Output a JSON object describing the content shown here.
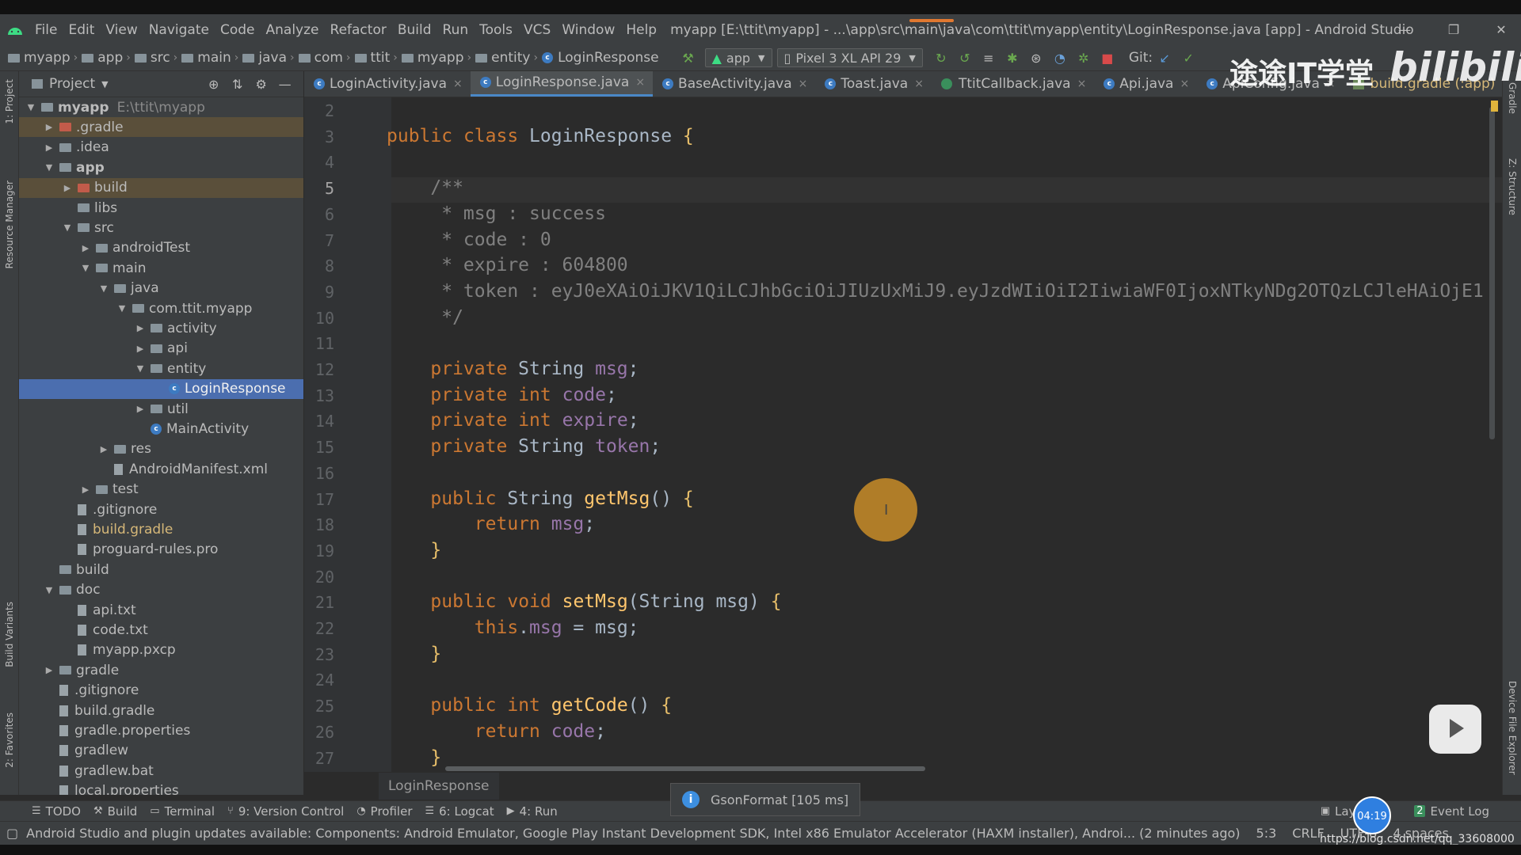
{
  "title_bar": {
    "menu": [
      "File",
      "Edit",
      "View",
      "Navigate",
      "Code",
      "Analyze",
      "Refactor",
      "Build",
      "Run",
      "Tools",
      "VCS",
      "Window",
      "Help"
    ],
    "window_title": "myapp [E:\\ttit\\myapp] - ...\\app\\src\\main\\java\\com\\ttit\\myapp\\entity\\LoginResponse.java [app] - Android Studio"
  },
  "nav": {
    "crumbs": [
      "myapp",
      "app",
      "src",
      "main",
      "java",
      "com",
      "ttit",
      "myapp",
      "entity",
      "LoginResponse"
    ],
    "run_config": "app",
    "device": "Pixel 3 XL API 29",
    "git_label": "Git:"
  },
  "project": {
    "header": "Project",
    "tree": [
      {
        "label": "myapp",
        "extra": "E:\\ttit\\myapp",
        "level": 0,
        "arrow": "▼"
      },
      {
        "label": ".gradle",
        "level": 1,
        "arrow": "▶",
        "style": "excluded"
      },
      {
        "label": ".idea",
        "level": 1,
        "arrow": "▶"
      },
      {
        "label": "app",
        "level": 1,
        "arrow": "▼"
      },
      {
        "label": "build",
        "level": 2,
        "arrow": "▶",
        "style": "excluded"
      },
      {
        "label": "libs",
        "level": 2,
        "arrow": ""
      },
      {
        "label": "src",
        "level": 2,
        "arrow": "▼"
      },
      {
        "label": "androidTest",
        "level": 3,
        "arrow": "▶"
      },
      {
        "label": "main",
        "level": 3,
        "arrow": "▼"
      },
      {
        "label": "java",
        "level": 4,
        "arrow": "▼"
      },
      {
        "label": "com.ttit.myapp",
        "level": 5,
        "arrow": "▼"
      },
      {
        "label": "activity",
        "level": 6,
        "arrow": "▶"
      },
      {
        "label": "api",
        "level": 6,
        "arrow": "▶"
      },
      {
        "label": "entity",
        "level": 6,
        "arrow": "▼"
      },
      {
        "label": "LoginResponse",
        "level": 7,
        "arrow": "",
        "style": "selected",
        "kind": "class"
      },
      {
        "label": "util",
        "level": 6,
        "arrow": "▶"
      },
      {
        "label": "MainActivity",
        "level": 6,
        "arrow": "",
        "kind": "class"
      },
      {
        "label": "res",
        "level": 4,
        "arrow": "▶"
      },
      {
        "label": "AndroidManifest.xml",
        "level": 4,
        "arrow": "",
        "kind": "file"
      },
      {
        "label": "test",
        "level": 3,
        "arrow": "▶"
      },
      {
        "label": ".gitignore",
        "level": 2,
        "arrow": "",
        "kind": "file"
      },
      {
        "label": "build.gradle",
        "level": 2,
        "arrow": "",
        "kind": "file"
      },
      {
        "label": "proguard-rules.pro",
        "level": 2,
        "arrow": "",
        "kind": "file"
      },
      {
        "label": "build",
        "level": 1,
        "arrow": ""
      },
      {
        "label": "doc",
        "level": 1,
        "arrow": "▼"
      },
      {
        "label": "api.txt",
        "level": 2,
        "arrow": "",
        "kind": "file"
      },
      {
        "label": "code.txt",
        "level": 2,
        "arrow": "",
        "kind": "file"
      },
      {
        "label": "myapp.pxcp",
        "level": 2,
        "arrow": "",
        "kind": "file"
      },
      {
        "label": "gradle",
        "level": 1,
        "arrow": "▶"
      },
      {
        "label": ".gitignore",
        "level": 1,
        "arrow": "",
        "kind": "file"
      },
      {
        "label": "build.gradle",
        "level": 1,
        "arrow": "",
        "kind": "file"
      },
      {
        "label": "gradle.properties",
        "level": 1,
        "arrow": "",
        "kind": "file"
      },
      {
        "label": "gradlew",
        "level": 1,
        "arrow": "",
        "kind": "file"
      },
      {
        "label": "gradlew.bat",
        "level": 1,
        "arrow": "",
        "kind": "file"
      },
      {
        "label": "local.properties",
        "level": 1,
        "arrow": "",
        "kind": "file"
      }
    ]
  },
  "tabs": [
    {
      "label": "LoginActivity.java",
      "kind": "class"
    },
    {
      "label": "LoginResponse.java",
      "kind": "class",
      "active": true
    },
    {
      "label": "BaseActivity.java",
      "kind": "class"
    },
    {
      "label": "Toast.java",
      "kind": "class"
    },
    {
      "label": "TtitCallback.java",
      "kind": "interface"
    },
    {
      "label": "Api.java",
      "kind": "class"
    },
    {
      "label": "ApiConfig.java",
      "kind": "class"
    },
    {
      "label": "build.gradle (:app)",
      "kind": "gradle"
    }
  ],
  "editor": {
    "current_line": 5,
    "lines": [
      {
        "n": 2,
        "t": ""
      },
      {
        "n": 3,
        "t": "public class LoginResponse {"
      },
      {
        "n": 4,
        "t": ""
      },
      {
        "n": 5,
        "t": "    /**"
      },
      {
        "n": 6,
        "t": "     * msg : success"
      },
      {
        "n": 7,
        "t": "     * code : 0"
      },
      {
        "n": 8,
        "t": "     * expire : 604800"
      },
      {
        "n": 9,
        "t": "     * token : eyJ0eXAiOiJKV1QiLCJhbGciOiJIUzUxMiJ9.eyJzdWIiOiI2IiwiaWF0IjoxNTkyNDg2OTQzLCJleHAiOjE1"
      },
      {
        "n": 10,
        "t": "     */"
      },
      {
        "n": 11,
        "t": ""
      },
      {
        "n": 12,
        "t": "    private String msg;"
      },
      {
        "n": 13,
        "t": "    private int code;"
      },
      {
        "n": 14,
        "t": "    private int expire;"
      },
      {
        "n": 15,
        "t": "    private String token;"
      },
      {
        "n": 16,
        "t": ""
      },
      {
        "n": 17,
        "t": "    public String getMsg() {"
      },
      {
        "n": 18,
        "t": "        return msg;"
      },
      {
        "n": 19,
        "t": "    }"
      },
      {
        "n": 20,
        "t": ""
      },
      {
        "n": 21,
        "t": "    public void setMsg(String msg) {"
      },
      {
        "n": 22,
        "t": "        this.msg = msg;"
      },
      {
        "n": 23,
        "t": "    }"
      },
      {
        "n": 24,
        "t": ""
      },
      {
        "n": 25,
        "t": "    public int getCode() {"
      },
      {
        "n": 26,
        "t": "        return code;"
      },
      {
        "n": 27,
        "t": "    }"
      }
    ],
    "breadcrumb": "LoginResponse"
  },
  "left_strip": [
    "1: Project",
    "Resource Manager",
    "Build Variants",
    "2: Favorites"
  ],
  "right_strip": [
    "Gradle",
    "Z: Structure",
    "Device File Explorer"
  ],
  "bottom_tools": [
    {
      "label": "TODO",
      "icon": "list-icon"
    },
    {
      "label": "Build",
      "icon": "hammer-icon"
    },
    {
      "label": "Terminal",
      "icon": "terminal-icon"
    },
    {
      "label": "9: Version Control",
      "icon": "vcs-icon"
    },
    {
      "label": "Profiler",
      "icon": "gauge-icon"
    },
    {
      "label": "6: Logcat",
      "icon": "logcat-icon"
    },
    {
      "label": "4: Run",
      "icon": "play-icon"
    }
  ],
  "bottom_right": {
    "layout": "Layout I",
    "event_log": "Event Log",
    "event_count": "2"
  },
  "toast": "GsonFormat [105 ms]",
  "status": {
    "message": "Android Studio and plugin updates available: Components: Android Emulator, Google Play Instant Development SDK, Intel x86 Emulator Accelerator (HAXM installer), Androi... (2 minutes ago)",
    "pos": "5:3",
    "le": "CRLF",
    "enc": "UTF-8",
    "indent": "4 spaces"
  },
  "overlay": {
    "watermark": "途途IT学堂",
    "brand": "bilibili",
    "timer": "04:19",
    "url": "https://blog.csdn.net/qq_33608000"
  },
  "colors": {
    "accent": "#4a88c7",
    "selected_row": "#4b6eaf",
    "keyword": "#cc7832",
    "function": "#ffc66d",
    "field": "#9876aa",
    "comment": "#808080"
  }
}
